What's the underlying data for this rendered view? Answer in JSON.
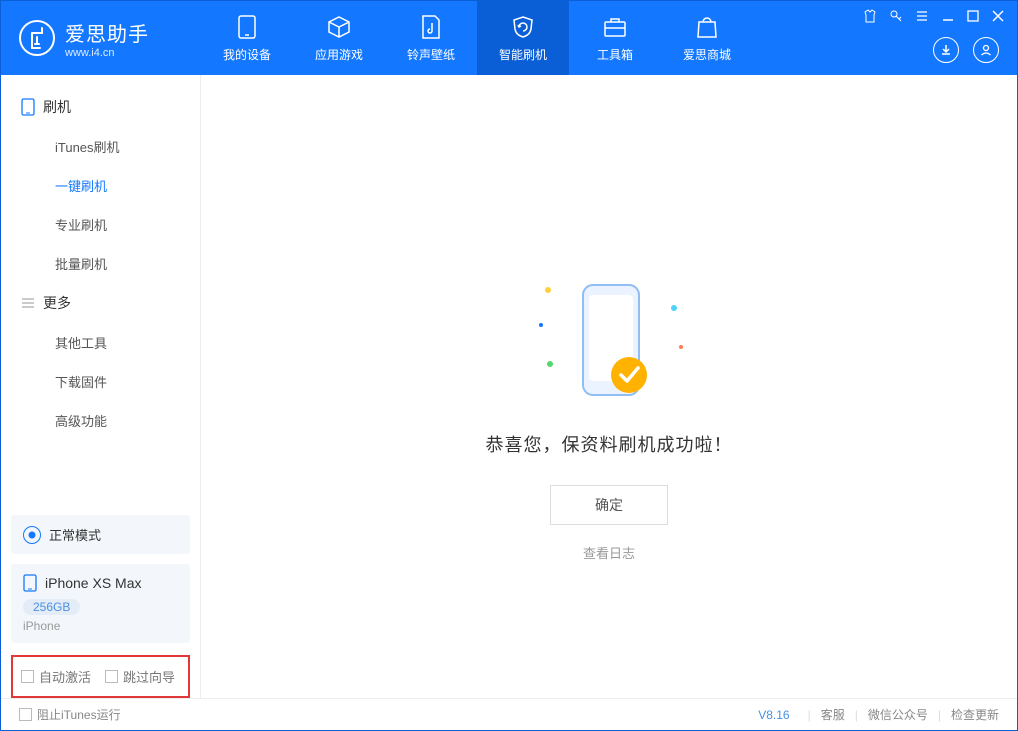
{
  "brand": {
    "name_cn": "爱思助手",
    "name_en": "www.i4.cn"
  },
  "nav": {
    "device": "我的设备",
    "apps": "应用游戏",
    "ringtones": "铃声壁纸",
    "flash": "智能刷机",
    "toolbox": "工具箱",
    "store": "爱思商城"
  },
  "sidebar": {
    "group_flash": "刷机",
    "items_flash": {
      "itunes": "iTunes刷机",
      "onekey": "一键刷机",
      "pro": "专业刷机",
      "batch": "批量刷机"
    },
    "group_more": "更多",
    "items_more": {
      "other": "其他工具",
      "firmware": "下载固件",
      "advanced": "高级功能"
    }
  },
  "mode": {
    "label": "正常模式"
  },
  "device": {
    "name": "iPhone XS Max",
    "capacity": "256GB",
    "type": "iPhone"
  },
  "checks": {
    "auto_activate": "自动激活",
    "skip_guide": "跳过向导"
  },
  "main": {
    "success_msg": "恭喜您，保资料刷机成功啦！",
    "ok": "确定",
    "view_log": "查看日志"
  },
  "footer": {
    "block_itunes": "阻止iTunes运行",
    "version": "V8.16",
    "support": "客服",
    "wechat": "微信公众号",
    "update": "检查更新"
  }
}
